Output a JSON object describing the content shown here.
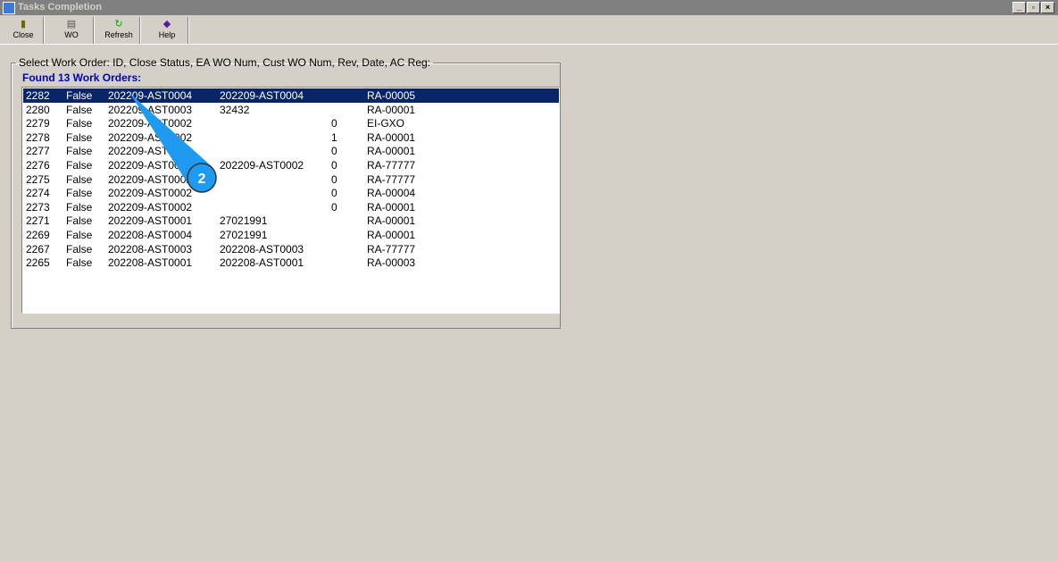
{
  "window": {
    "title": "Tasks Completion"
  },
  "toolbar": [
    {
      "label": "Close",
      "icon": "door-exit-icon"
    },
    {
      "label": "WO",
      "icon": "printer-icon"
    },
    {
      "label": "Refresh",
      "icon": "refresh-arrow-icon"
    },
    {
      "label": "Help",
      "icon": "help-book-icon"
    }
  ],
  "group": {
    "legend": "Select Work Order: ID, Close Status, EA WO Num, Cust WO Num, Rev, Date, AC Reg:",
    "found": "Found 13 Work Orders:"
  },
  "rows": [
    [
      "2282",
      "False",
      "202209-AST0004",
      "202209-AST0004",
      "",
      "RA-00005"
    ],
    [
      "2280",
      "False",
      "202209-AST0003",
      "32432",
      "",
      "RA-00001"
    ],
    [
      "2279",
      "False",
      "202209-AST0002",
      "",
      "0",
      "EI-GXO"
    ],
    [
      "2278",
      "False",
      "202209-AST0002",
      "",
      "1",
      "RA-00001"
    ],
    [
      "2277",
      "False",
      "202209-AST0002",
      "",
      "0",
      "RA-00001"
    ],
    [
      "2276",
      "False",
      "202209-AST0002",
      "202209-AST0002",
      "0",
      "RA-77777"
    ],
    [
      "2275",
      "False",
      "202209-AST0002",
      "",
      "0",
      "RA-77777"
    ],
    [
      "2274",
      "False",
      "202209-AST0002",
      "",
      "0",
      "RA-00004"
    ],
    [
      "2273",
      "False",
      "202209-AST0002",
      "",
      "0",
      "RA-00001"
    ],
    [
      "2271",
      "False",
      "202209-AST0001",
      "27021991",
      "",
      "RA-00001"
    ],
    [
      "2269",
      "False",
      "202208-AST0004",
      "27021991",
      "",
      "RA-00001"
    ],
    [
      "2267",
      "False",
      "202208-AST0003",
      "202208-AST0003",
      "",
      "RA-77777"
    ],
    [
      "2265",
      "False",
      "202208-AST0001",
      "202208-AST0001",
      "",
      "RA-00003"
    ]
  ],
  "selected_index": 0,
  "callout": {
    "number": "2",
    "color": "#1e9bf0"
  }
}
